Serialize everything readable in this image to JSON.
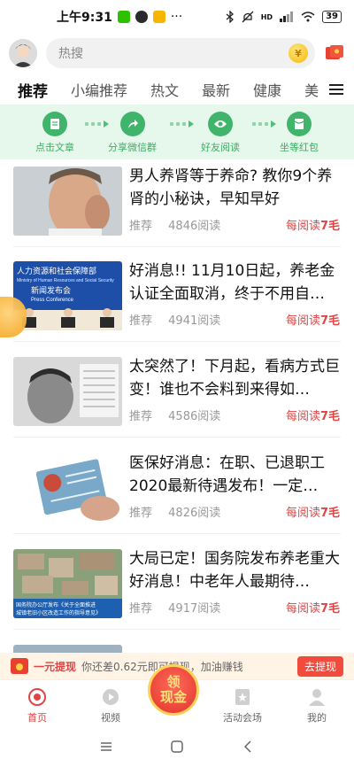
{
  "status_bar": {
    "time": "上午9:31",
    "extra": "···",
    "network": "HD",
    "battery": "39"
  },
  "search": {
    "placeholder": "热搜",
    "coin_symbol": "¥"
  },
  "tabs": [
    {
      "label": "推荐",
      "active": true
    },
    {
      "label": "小编推荐",
      "active": false
    },
    {
      "label": "热文",
      "active": false
    },
    {
      "label": "最新",
      "active": false
    },
    {
      "label": "健康",
      "active": false
    },
    {
      "label": "美文",
      "active": false
    }
  ],
  "steps": [
    {
      "label": "点击文章",
      "icon": "document-icon"
    },
    {
      "label": "分享微信群",
      "icon": "share-icon"
    },
    {
      "label": "好友阅读",
      "icon": "eye-icon"
    },
    {
      "label": "坐等红包",
      "icon": "red-packet-icon"
    }
  ],
  "articles": [
    {
      "title": "男人养肾等于养命? 教你9个养肾的小秘诀，早知早好",
      "tag": "推荐",
      "reads": "4846阅读",
      "reward_prefix": "每阅读",
      "reward_value": "7毛"
    },
    {
      "title": "好消息!! 11月10日起，养老金认证全面取消，终于不用自…",
      "tag": "推荐",
      "reads": "4941阅读",
      "reward_prefix": "每阅读",
      "reward_value": "7毛"
    },
    {
      "title": "太突然了！下月起，看病方式巨变！谁也不会料到来得如…",
      "tag": "推荐",
      "reads": "4586阅读",
      "reward_prefix": "每阅读",
      "reward_value": "7毛"
    },
    {
      "title": "医保好消息：在职、已退职工2020最新待遇发布！一定…",
      "tag": "推荐",
      "reads": "4826阅读",
      "reward_prefix": "每阅读",
      "reward_value": "7毛"
    },
    {
      "title": "大局已定！国务院发布养老重大好消息！中老年人最期待…",
      "tag": "推荐",
      "reads": "4917阅读",
      "reward_prefix": "每阅读",
      "reward_value": "7毛"
    }
  ],
  "thumb_text": {
    "press_banner_1": "人力资源和社会保障部",
    "press_banner_2": "Ministry of Human Resources and Social Security",
    "press_banner_3": "新闻发布会",
    "press_banner_4": "Press Conference",
    "aerial_caption_1": "国务院办公厅发布《关于全面推进",
    "aerial_caption_2": "城镇老旧小区改造工作的指导意见》"
  },
  "withdraw": {
    "strong": "一元提现",
    "text": "你还差0.62元即可提现，加油赚钱",
    "button": "去提现"
  },
  "bottom_nav": [
    {
      "label": "首页",
      "active": true
    },
    {
      "label": "视频",
      "active": false
    },
    {
      "label": "活动会场",
      "active": false
    },
    {
      "label": "我的",
      "active": false
    }
  ],
  "center_button": {
    "line1": "领",
    "line2": "现金"
  },
  "colors": {
    "accent": "#e04545",
    "green": "#3fb46a",
    "banner_bg": "#e6f7ec"
  }
}
